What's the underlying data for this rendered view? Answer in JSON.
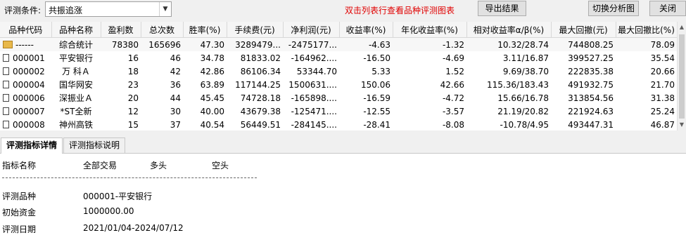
{
  "toolbar": {
    "condition_label": "评测条件:",
    "condition_value": "共振追涨",
    "hint": "双击列表行查看品种评测图表",
    "export_label": "导出结果",
    "switch_label": "切换分析图",
    "close_label": "关闭"
  },
  "table": {
    "columns": [
      "品种代码",
      "品种名称",
      "盈利数",
      "总次数",
      "胜率(%)",
      "手续费(元)",
      "净利润(元)",
      "收益率(%)",
      "年化收益率(%)",
      "相对收益率α/β(%)",
      "最大回撤(元)",
      "最大回撤比(%)"
    ],
    "rows": [
      {
        "code": "------",
        "name": "综合统计",
        "win": "78380",
        "total": "165696",
        "winrate": "47.30",
        "fee": "3289479...",
        "profit": "-2475177...",
        "ret": "-4.63",
        "annual": "-1.32",
        "relative": "10.32/28.74",
        "maxdd": "744808.25",
        "maxddpct": "78.09",
        "icon": "folder-icon"
      },
      {
        "code": "000001",
        "name": "平安银行",
        "win": "16",
        "total": "46",
        "winrate": "34.78",
        "fee": "81833.02",
        "profit": "-164962....",
        "ret": "-16.50",
        "annual": "-4.69",
        "relative": "3.11/16.87",
        "maxdd": "399527.25",
        "maxddpct": "35.54",
        "icon": "file-icon"
      },
      {
        "code": "000002",
        "name": "万 科Ａ",
        "win": "18",
        "total": "42",
        "winrate": "42.86",
        "fee": "86106.34",
        "profit": "53344.70",
        "ret": "5.33",
        "annual": "1.52",
        "relative": "9.69/38.70",
        "maxdd": "222835.38",
        "maxddpct": "20.66",
        "icon": "file-icon"
      },
      {
        "code": "000004",
        "name": "国华网安",
        "win": "23",
        "total": "36",
        "winrate": "63.89",
        "fee": "117144.25",
        "profit": "1500631....",
        "ret": "150.06",
        "annual": "42.66",
        "relative": "115.36/183.43",
        "maxdd": "491932.75",
        "maxddpct": "21.70",
        "icon": "file-icon"
      },
      {
        "code": "000006",
        "name": "深振业Ａ",
        "win": "20",
        "total": "44",
        "winrate": "45.45",
        "fee": "74728.18",
        "profit": "-165898....",
        "ret": "-16.59",
        "annual": "-4.72",
        "relative": "15.66/16.78",
        "maxdd": "313854.56",
        "maxddpct": "31.38",
        "icon": "file-icon"
      },
      {
        "code": "000007",
        "name": "*ST全新",
        "win": "12",
        "total": "30",
        "winrate": "40.00",
        "fee": "43679.38",
        "profit": "-125471....",
        "ret": "-12.55",
        "annual": "-3.57",
        "relative": "21.19/20.82",
        "maxdd": "221924.63",
        "maxddpct": "25.24",
        "icon": "file-icon"
      },
      {
        "code": "000008",
        "name": "神州高铁",
        "win": "15",
        "total": "37",
        "winrate": "40.54",
        "fee": "56449.51",
        "profit": "-284145....",
        "ret": "-28.41",
        "annual": "-8.08",
        "relative": "-10.78/4.95",
        "maxdd": "493447.31",
        "maxddpct": "46.87",
        "icon": "file-icon"
      }
    ]
  },
  "tabs": {
    "detail": "评测指标详情",
    "explain": "评测指标说明"
  },
  "detail": {
    "header": {
      "name": "指标名称",
      "all": "全部交易",
      "long": "多头",
      "short": "空头"
    },
    "items": [
      {
        "label": "评测品种",
        "value": "000001-平安银行"
      },
      {
        "label": "初始资金",
        "value": "1000000.00"
      },
      {
        "label": "评测日期",
        "value": "2021/01/04-2024/07/12"
      }
    ]
  },
  "icons": {
    "dropdown": "chevron-down-icon",
    "scroll_up": "arrow-up-icon",
    "scroll_down": "arrow-down-icon"
  }
}
